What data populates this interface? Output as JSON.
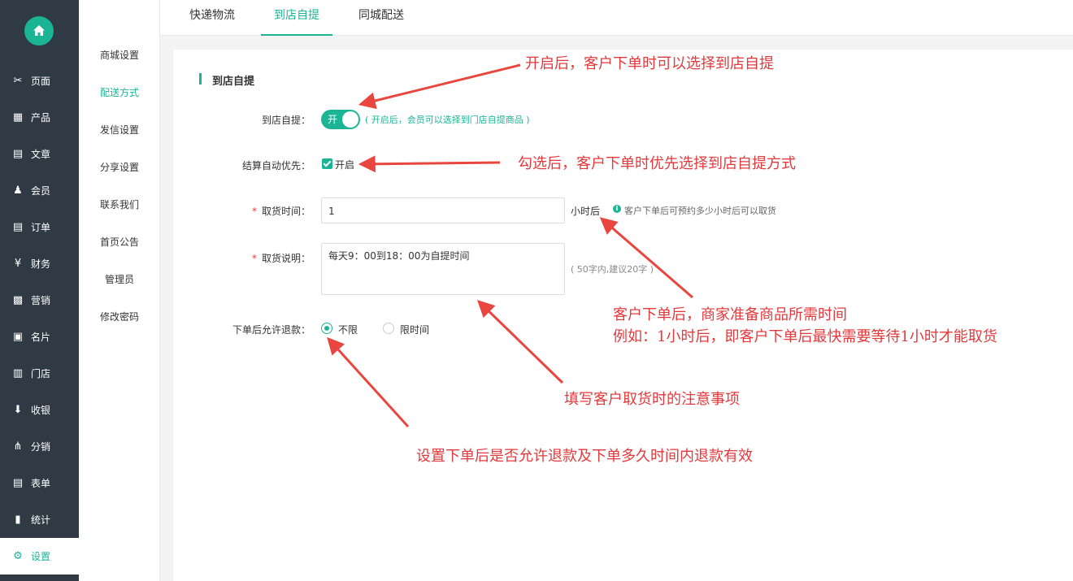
{
  "sidebar": {
    "items": [
      {
        "label": "页面",
        "icon": "tools-icon",
        "glyph": "✂"
      },
      {
        "label": "产品",
        "icon": "grid-icon",
        "glyph": "▦"
      },
      {
        "label": "文章",
        "icon": "document-icon",
        "glyph": "▤"
      },
      {
        "label": "会员",
        "icon": "member-icon",
        "glyph": "♟"
      },
      {
        "label": "订单",
        "icon": "order-icon",
        "glyph": "▤"
      },
      {
        "label": "财务",
        "icon": "yen-icon",
        "glyph": "¥"
      },
      {
        "label": "营销",
        "icon": "gift-icon",
        "glyph": "▩"
      },
      {
        "label": "名片",
        "icon": "card-icon",
        "glyph": "▣"
      },
      {
        "label": "门店",
        "icon": "store-icon",
        "glyph": "▥"
      },
      {
        "label": "收银",
        "icon": "cashier-icon",
        "glyph": "⬇"
      },
      {
        "label": "分销",
        "icon": "hierarchy-icon",
        "glyph": "⋔"
      },
      {
        "label": "表单",
        "icon": "form-icon",
        "glyph": "▤"
      },
      {
        "label": "统计",
        "icon": "chart-icon",
        "glyph": "▮"
      },
      {
        "label": "设置",
        "icon": "gear-icon",
        "glyph": "⚙"
      }
    ]
  },
  "submenu": {
    "items": [
      "商城设置",
      "配送方式",
      "发信设置",
      "分享设置",
      "联系我们",
      "首页公告",
      "管理员",
      "修改密码"
    ]
  },
  "tabs": [
    "快递物流",
    "到店自提",
    "同城配送"
  ],
  "form": {
    "section_title": "到店自提",
    "pickup_label": "到店自提：",
    "switch_text": "开",
    "pickup_hint": "( 开启后，会员可以选择到门店自提商品 )",
    "priority_label": "结算自动优先：",
    "priority_check_label": "开启",
    "time_label": "取货时间：",
    "time_value": "1",
    "time_unit": "小时后",
    "time_hint": "客户下单后可预约多少小时后可以取货",
    "desc_label": "取货说明：",
    "desc_value": "每天9：00到18：00为自提时间",
    "desc_hint": "( 50字内,建议20字 )",
    "refund_label": "下单后允许退款：",
    "refund_options": [
      "不限",
      "限时间"
    ]
  },
  "annotations": {
    "a1": "开启后，客户下单时可以选择到店自提",
    "a2": "勾选后，客户下单时优先选择到店自提方式",
    "a3_line1": "客户下单后，商家准备商品所需时间",
    "a3_line2": "例如：1小时后，即客户下单后最快需要等待1小时才能取货",
    "a4": "填写客户取货时的注意事项",
    "a5": "设置下单后是否允许退款及下单多久时间内退款有效"
  },
  "colors": {
    "accent": "#1bb595",
    "sidebar": "#2f3a44",
    "annotation": "#e4393c"
  }
}
